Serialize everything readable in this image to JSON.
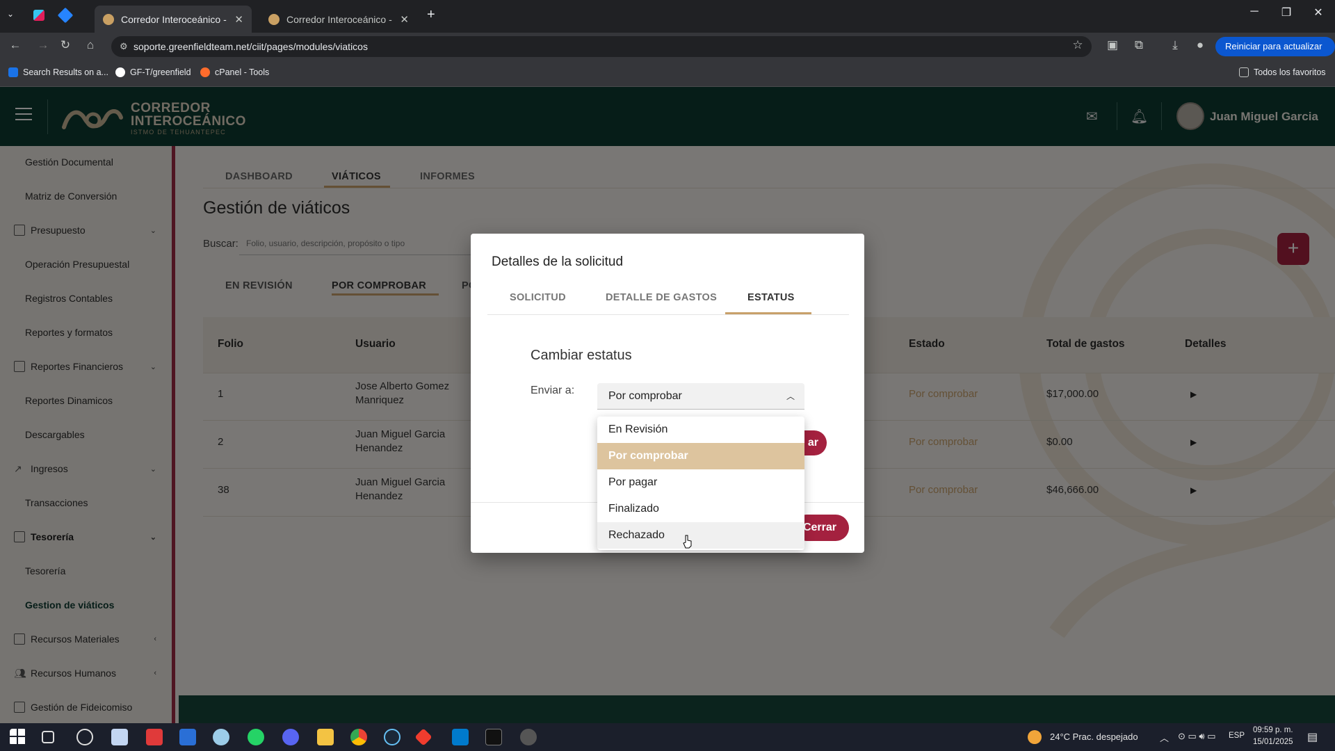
{
  "browser": {
    "tabs": [
      {
        "title": "Corredor Interoceánico - Istmo",
        "active": true
      },
      {
        "title": "Corredor Interoceánico - Istmo",
        "active": false
      }
    ],
    "url": "soporte.greenfieldteam.net/ciit/pages/modules/viaticos",
    "update_button": "Reiniciar para actualizar",
    "bookmarks": [
      "Search Results on a...",
      "GF-T/greenfield",
      "cPanel - Tools"
    ],
    "all_bookmarks": "Todos los favoritos"
  },
  "header": {
    "logo_line1": "CORREDOR",
    "logo_line2": "INTEROCEÁNICO",
    "logo_line3": "ISTMO DE TEHUANTEPEC",
    "user_name": "Juan Miguel Garcia",
    "icons": [
      "menu-icon",
      "mail-icon",
      "bell-icon"
    ]
  },
  "sidebar": {
    "items": [
      {
        "label": "Gestión Documental",
        "type": "sub"
      },
      {
        "label": "Matriz de Conversión",
        "type": "sub"
      },
      {
        "label": "Presupuesto",
        "type": "group",
        "chevron": "down"
      },
      {
        "label": "Operación Presupuestal",
        "type": "sub"
      },
      {
        "label": "Registros Contables",
        "type": "sub"
      },
      {
        "label": "Reportes y formatos",
        "type": "sub"
      },
      {
        "label": "Reportes Financieros",
        "type": "group",
        "chevron": "down"
      },
      {
        "label": "Reportes Dinamicos",
        "type": "sub"
      },
      {
        "label": "Descargables",
        "type": "sub"
      },
      {
        "label": "Ingresos",
        "type": "group",
        "chevron": "down"
      },
      {
        "label": "Transacciones",
        "type": "sub"
      },
      {
        "label": "Tesorería",
        "type": "group",
        "chevron": "down",
        "active": true
      },
      {
        "label": "Tesorería",
        "type": "sub"
      },
      {
        "label": "Gestion de viáticos",
        "type": "sub",
        "active": true
      },
      {
        "label": "Recursos Materiales",
        "type": "group",
        "chevron": "left"
      },
      {
        "label": "Recursos Humanos",
        "type": "group",
        "chevron": "left"
      },
      {
        "label": "Gestión de Fideicomiso",
        "type": "group"
      }
    ]
  },
  "main": {
    "tabs": [
      "DASHBOARD",
      "VIÁTICOS",
      "INFORMES"
    ],
    "active_tab": "VIÁTICOS",
    "title": "Gestión de viáticos",
    "search_label": "Buscar:",
    "search_placeholder": "Folio, usuario, descripción, propósito o tipo",
    "add_button": "+",
    "status_tabs": [
      "EN REVISIÓN",
      "POR COMPROBAR",
      "PO"
    ],
    "active_status_tab": "POR COMPROBAR",
    "table": {
      "headers": [
        "Folio",
        "Usuario",
        "Estado",
        "Total de gastos",
        "Detalles"
      ],
      "rows": [
        {
          "folio": "1",
          "usuario_1": "Jose Alberto Gomez",
          "usuario_2": "Manriquez",
          "estado": "Por comprobar",
          "total": "$17,000.00"
        },
        {
          "folio": "2",
          "usuario_1": "Juan Miguel Garcia",
          "usuario_2": "Henandez",
          "estado": "Por comprobar",
          "total": "$0.00"
        },
        {
          "folio": "38",
          "usuario_1": "Juan Miguel Garcia",
          "usuario_2": "Henandez",
          "estado": "Por comprobar",
          "total": "$46,666.00"
        }
      ]
    }
  },
  "modal": {
    "title": "Detalles de la solicitud",
    "tabs": [
      "SOLICITUD",
      "DETALLE DE GASTOS",
      "ESTATUS"
    ],
    "active_tab": "ESTATUS",
    "section_title": "Cambiar estatus",
    "send_to_label": "Enviar a:",
    "select_value": "Por comprobar",
    "options": [
      "En Revisión",
      "Por comprobar",
      "Por pagar",
      "Finalizado",
      "Rechazado"
    ],
    "selected_option": "Por comprobar",
    "hovered_option": "Rechazado",
    "hidden_button_fragment": "ar",
    "close_button_fragment": "Cerrar"
  },
  "taskbar": {
    "weather": "24°C  Prac. despejado",
    "lang": "ESP",
    "time": "09:59 p. m.",
    "date": "15/01/2025"
  },
  "colors": {
    "header_bg": "#0d3a31",
    "accent": "#a4213f",
    "gold": "#c8a06a",
    "sidebar_bg": "#ede9e2"
  }
}
